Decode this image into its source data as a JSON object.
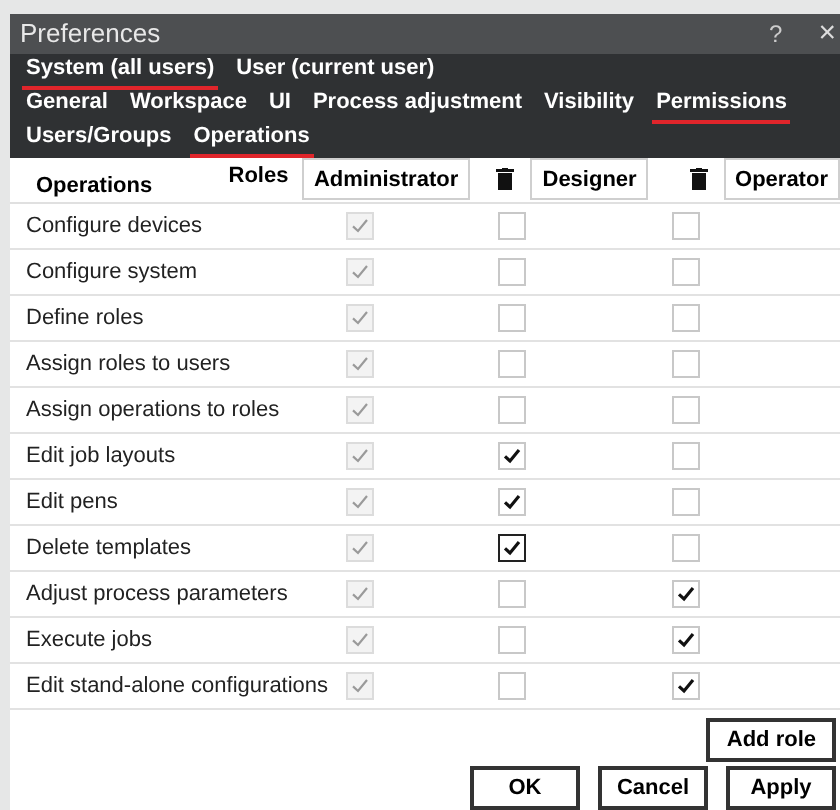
{
  "window": {
    "title": "Preferences",
    "help": "?",
    "close": "×"
  },
  "scope_tabs": [
    {
      "label": "System (all users)",
      "selected": true
    },
    {
      "label": "User (current user)",
      "selected": false
    }
  ],
  "section_tabs": [
    {
      "label": "General",
      "selected": false
    },
    {
      "label": "Workspace",
      "selected": false
    },
    {
      "label": "UI",
      "selected": false
    },
    {
      "label": "Process adjustment",
      "selected": false
    },
    {
      "label": "Visibility",
      "selected": false
    },
    {
      "label": "Permissions",
      "selected": true
    }
  ],
  "sub_tabs": [
    {
      "label": "Users/Groups",
      "selected": false
    },
    {
      "label": "Operations",
      "selected": true
    }
  ],
  "table": {
    "operations_header": "Operations",
    "roles_header": "Roles",
    "roles": [
      {
        "name": "Administrator",
        "deletable": false
      },
      {
        "name": "Designer",
        "deletable": true
      },
      {
        "name": "Operator",
        "deletable": true
      }
    ],
    "rows": [
      {
        "operation": "Configure devices",
        "cells": [
          {
            "checked": true,
            "disabled": true,
            "focused": false
          },
          {
            "checked": false,
            "disabled": false,
            "focused": false
          },
          {
            "checked": false,
            "disabled": false,
            "focused": false
          }
        ]
      },
      {
        "operation": "Configure system",
        "cells": [
          {
            "checked": true,
            "disabled": true,
            "focused": false
          },
          {
            "checked": false,
            "disabled": false,
            "focused": false
          },
          {
            "checked": false,
            "disabled": false,
            "focused": false
          }
        ]
      },
      {
        "operation": "Define roles",
        "cells": [
          {
            "checked": true,
            "disabled": true,
            "focused": false
          },
          {
            "checked": false,
            "disabled": false,
            "focused": false
          },
          {
            "checked": false,
            "disabled": false,
            "focused": false
          }
        ]
      },
      {
        "operation": "Assign roles to users",
        "cells": [
          {
            "checked": true,
            "disabled": true,
            "focused": false
          },
          {
            "checked": false,
            "disabled": false,
            "focused": false
          },
          {
            "checked": false,
            "disabled": false,
            "focused": false
          }
        ]
      },
      {
        "operation": "Assign operations to roles",
        "cells": [
          {
            "checked": true,
            "disabled": true,
            "focused": false
          },
          {
            "checked": false,
            "disabled": false,
            "focused": false
          },
          {
            "checked": false,
            "disabled": false,
            "focused": false
          }
        ]
      },
      {
        "operation": "Edit job layouts",
        "cells": [
          {
            "checked": true,
            "disabled": true,
            "focused": false
          },
          {
            "checked": true,
            "disabled": false,
            "focused": false
          },
          {
            "checked": false,
            "disabled": false,
            "focused": false
          }
        ]
      },
      {
        "operation": "Edit pens",
        "cells": [
          {
            "checked": true,
            "disabled": true,
            "focused": false
          },
          {
            "checked": true,
            "disabled": false,
            "focused": false
          },
          {
            "checked": false,
            "disabled": false,
            "focused": false
          }
        ]
      },
      {
        "operation": "Delete templates",
        "cells": [
          {
            "checked": true,
            "disabled": true,
            "focused": false
          },
          {
            "checked": true,
            "disabled": false,
            "focused": true
          },
          {
            "checked": false,
            "disabled": false,
            "focused": false
          }
        ]
      },
      {
        "operation": "Adjust process parameters",
        "cells": [
          {
            "checked": true,
            "disabled": true,
            "focused": false
          },
          {
            "checked": false,
            "disabled": false,
            "focused": false
          },
          {
            "checked": true,
            "disabled": false,
            "focused": false
          }
        ]
      },
      {
        "operation": "Execute jobs",
        "cells": [
          {
            "checked": true,
            "disabled": true,
            "focused": false
          },
          {
            "checked": false,
            "disabled": false,
            "focused": false
          },
          {
            "checked": true,
            "disabled": false,
            "focused": false
          }
        ]
      },
      {
        "operation": "Edit stand-alone configurations",
        "cells": [
          {
            "checked": true,
            "disabled": true,
            "focused": false
          },
          {
            "checked": false,
            "disabled": false,
            "focused": false
          },
          {
            "checked": true,
            "disabled": false,
            "focused": false
          }
        ]
      }
    ]
  },
  "add_role_button": "Add role",
  "buttons": [
    "OK",
    "Cancel",
    "Apply"
  ]
}
